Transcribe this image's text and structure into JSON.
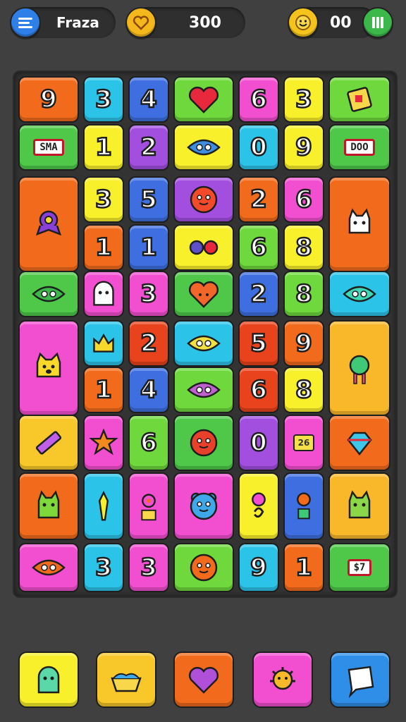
{
  "topbar": {
    "title": "Fraza",
    "score": "300",
    "coins": "00",
    "menu_icon": "menu-icon",
    "pause_icon": "pause-icon",
    "colors": {
      "menu": "#2f7fe8",
      "heart_coin": "#f4b81c",
      "pause": "#3cb84a"
    }
  },
  "board": {
    "tiles": [
      {
        "text": "9",
        "kind": "num",
        "color": "#f26b1d"
      },
      {
        "text": "3",
        "kind": "num",
        "color": "#2cc3e8"
      },
      {
        "text": "4",
        "kind": "num",
        "color": "#3e6ee0"
      },
      {
        "text": "",
        "kind": "icon",
        "icon": "heart-icon",
        "color": "#6ed83c"
      },
      {
        "text": "6",
        "kind": "num",
        "color": "#f24fd0"
      },
      {
        "text": "3",
        "kind": "num",
        "color": "#f8f02a"
      },
      {
        "text": "",
        "kind": "icon",
        "icon": "puzzle-card-icon",
        "color": "#6ed83c"
      },
      {
        "text": "SMA",
        "kind": "lbl",
        "color": "#4fc84a"
      },
      {
        "text": "1",
        "kind": "num",
        "color": "#f8f02a"
      },
      {
        "text": "2",
        "kind": "num",
        "color": "#a24fe0"
      },
      {
        "text": "",
        "kind": "icon",
        "icon": "blue-fish-icon",
        "color": "#f8f02a"
      },
      {
        "text": "0",
        "kind": "num",
        "color": "#2cc3e8"
      },
      {
        "text": "9",
        "kind": "num",
        "color": "#f8f02a"
      },
      {
        "text": "DOO",
        "kind": "lbl",
        "color": "#4fc84a"
      },
      {
        "text": "",
        "kind": "icon",
        "icon": "purple-owl-icon",
        "color": "#f26b1d"
      },
      {
        "text": "3",
        "kind": "num",
        "color": "#f8f02a"
      },
      {
        "text": "5",
        "kind": "num",
        "color": "#3e6ee0"
      },
      {
        "text": "",
        "kind": "icon",
        "icon": "red-blob-icon",
        "color": "#a24fe0"
      },
      {
        "text": "2",
        "kind": "num",
        "color": "#f26b1d"
      },
      {
        "text": "6",
        "kind": "num",
        "color": "#f24fd0"
      },
      {
        "text": "",
        "kind": "icon",
        "icon": "white-cat-icon",
        "color": "#f26b1d"
      },
      {
        "text": "1",
        "kind": "num",
        "color": "#f26b1d"
      },
      {
        "text": "1",
        "kind": "num",
        "color": "#3e6ee0"
      },
      {
        "text": "",
        "kind": "icon",
        "icon": "glasses-icon",
        "color": "#f8f02a"
      },
      {
        "text": "6",
        "kind": "num",
        "color": "#6ed83c"
      },
      {
        "text": "8",
        "kind": "num",
        "color": "#f8f02a"
      },
      {
        "text": "",
        "kind": "icon",
        "icon": "green-leaf-icon",
        "color": "#4fc84a"
      },
      {
        "text": "",
        "kind": "icon",
        "icon": "white-ghost-icon",
        "color": "#f24fd0"
      },
      {
        "text": "3",
        "kind": "num",
        "color": "#f24fd0"
      },
      {
        "text": "",
        "kind": "icon",
        "icon": "orange-heart-icon",
        "color": "#4fc84a"
      },
      {
        "text": "2",
        "kind": "num",
        "color": "#3e6ee0"
      },
      {
        "text": "8",
        "kind": "num",
        "color": "#6ed83c"
      },
      {
        "text": "",
        "kind": "icon",
        "icon": "teal-leaf-icon",
        "color": "#2cc3e8"
      },
      {
        "text": "",
        "kind": "icon",
        "icon": "yellow-dog-icon",
        "color": "#f24fd0"
      },
      {
        "text": "",
        "kind": "icon",
        "icon": "yellow-crown-icon",
        "color": "#2cc3e8"
      },
      {
        "text": "2",
        "kind": "num",
        "color": "#e8431c"
      },
      {
        "text": "",
        "kind": "icon",
        "icon": "yellow-fish-icon",
        "color": "#2cc3e8"
      },
      {
        "text": "5",
        "kind": "num",
        "color": "#e8431c"
      },
      {
        "text": "9",
        "kind": "num",
        "color": "#f26b1d"
      },
      {
        "text": "",
        "kind": "icon",
        "icon": "green-monster-icon",
        "color": "#f8b82a"
      },
      {
        "text": "1",
        "kind": "num",
        "color": "#f26b1d"
      },
      {
        "text": "4",
        "kind": "num",
        "color": "#3e6ee0"
      },
      {
        "text": "",
        "kind": "icon",
        "icon": "snail-icon",
        "color": "#6ed83c"
      },
      {
        "text": "6",
        "kind": "num",
        "color": "#e8431c"
      },
      {
        "text": "8",
        "kind": "num",
        "color": "#f8f02a"
      },
      {
        "text": "",
        "kind": "icon",
        "icon": "crayon-icon",
        "color": "#f8c82a"
      },
      {
        "text": "",
        "kind": "icon",
        "icon": "orange-star-icon",
        "color": "#f24fd0"
      },
      {
        "text": "6",
        "kind": "num",
        "color": "#6ed83c"
      },
      {
        "text": "",
        "kind": "icon",
        "icon": "red-ball-icon",
        "color": "#4fc84a"
      },
      {
        "text": "0",
        "kind": "num",
        "color": "#a24fe0"
      },
      {
        "text": "26",
        "kind": "tag",
        "color": "#f24fd0"
      },
      {
        "text": "",
        "kind": "icon",
        "icon": "diamond-icon",
        "color": "#f26b1d"
      },
      {
        "text": "",
        "kind": "icon",
        "icon": "green-cat-icon",
        "color": "#f26b1d"
      },
      {
        "text": "",
        "kind": "icon",
        "icon": "yellow-key-icon",
        "color": "#2cc3e8"
      },
      {
        "text": "",
        "kind": "icon",
        "icon": "pink-swirl-icon",
        "color": "#f24fd0"
      },
      {
        "text": "",
        "kind": "icon",
        "icon": "blue-bear-icon",
        "color": "#f24fd0"
      },
      {
        "text": "",
        "kind": "icon",
        "icon": "pink-swirl-2-icon",
        "color": "#f8f02a"
      },
      {
        "text": "",
        "kind": "icon",
        "icon": "orange-swirl-icon",
        "color": "#3e6ee0"
      },
      {
        "text": "",
        "kind": "icon",
        "icon": "green-bear-icon",
        "color": "#f8b82a"
      },
      {
        "text": "",
        "kind": "icon",
        "icon": "orange-fish-icon",
        "color": "#f24fd0"
      },
      {
        "text": "3",
        "kind": "num",
        "color": "#2cc3e8"
      },
      {
        "text": "3",
        "kind": "num",
        "color": "#f24fd0"
      },
      {
        "text": "",
        "kind": "icon",
        "icon": "sun-icon",
        "color": "#6ed83c"
      },
      {
        "text": "9",
        "kind": "num",
        "color": "#2cc3e8"
      },
      {
        "text": "1",
        "kind": "num",
        "color": "#f26b1d"
      },
      {
        "text": "$7",
        "kind": "lbl",
        "color": "#4fc84a"
      }
    ]
  },
  "dock": {
    "items": [
      {
        "icon": "green-ghost-icon",
        "color": "#f8f02a"
      },
      {
        "icon": "water-bowl-icon",
        "color": "#f8c82a"
      },
      {
        "icon": "purple-heart-icon",
        "color": "#f26b1d"
      },
      {
        "icon": "orange-bug-icon",
        "color": "#f24fd0"
      },
      {
        "icon": "note-card-icon",
        "color": "#2f8fe8"
      }
    ]
  }
}
